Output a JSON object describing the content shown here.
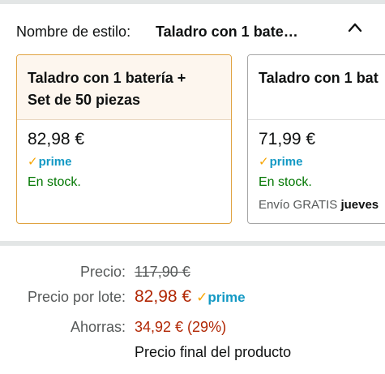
{
  "style_selector": {
    "label": "Nombre de estilo:",
    "selected_value": "Taladro con 1 bate…",
    "expand_icon": "chevron-up-icon"
  },
  "options": [
    {
      "title_line1": "Taladro con 1 batería +",
      "title_line2": "Set de 50 piezas",
      "price": "82,98 €",
      "prime": "prime",
      "stock": "En stock.",
      "selected": true
    },
    {
      "title_line1": "Taladro con 1 bat",
      "price": "71,99 €",
      "prime": "prime",
      "stock": "En stock.",
      "shipping_prefix": "Envío GRATIS",
      "shipping_day": "jueves",
      "selected": false
    }
  ],
  "pricing": {
    "list_label": "Precio:",
    "list_value": "117,90 €",
    "deal_label": "Precio por lote:",
    "deal_value": "82,98 €",
    "deal_prime": "prime",
    "savings_label": "Ahorras:",
    "savings_value": "34,92 € (29%)",
    "final_note": "Precio final del producto"
  },
  "colors": {
    "price_red": "#b12704",
    "prime_blue": "#1399c4",
    "prime_check": "#f7a400",
    "in_stock_green": "#007600",
    "selected_border": "#e0a341"
  }
}
